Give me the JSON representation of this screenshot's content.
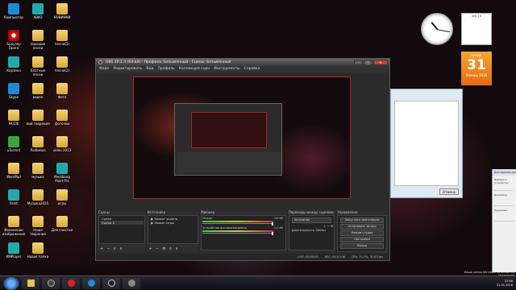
{
  "desktop": {
    "icons": [
      {
        "label": "Компьютер",
        "type": "computer"
      },
      {
        "label": "АВИЗ",
        "type": "app"
      },
      {
        "label": "НОВИНКИ",
        "type": "folder"
      },
      {
        "label": "Браузер Opera",
        "type": "opera"
      },
      {
        "label": "хорошие песни",
        "type": "folder"
      },
      {
        "label": "песни(1)",
        "type": "folder"
      },
      {
        "label": "Корзина",
        "type": "trash"
      },
      {
        "label": "Блатные песни",
        "type": "folder"
      },
      {
        "label": "песни(2)",
        "type": "folder"
      },
      {
        "label": "Skype",
        "type": "skype"
      },
      {
        "label": "видео",
        "type": "folder"
      },
      {
        "label": "Фото",
        "type": "folder"
      },
      {
        "label": "MUZIK",
        "type": "folder"
      },
      {
        "label": "мой творения",
        "type": "folder"
      },
      {
        "label": "фоточки",
        "type": "folder"
      },
      {
        "label": "uTorrent",
        "type": "utorrent"
      },
      {
        "label": "Любимое",
        "type": "folder"
      },
      {
        "label": "video 2013",
        "type": "folder"
      },
      {
        "label": "WordPad",
        "type": "folder"
      },
      {
        "label": "музыка",
        "type": "folder"
      },
      {
        "label": "Medibang Paint Pro",
        "type": "app"
      },
      {
        "label": "Paint",
        "type": "app"
      },
      {
        "label": "Музыка2015",
        "type": "folder"
      },
      {
        "label": "игры",
        "type": "folder"
      },
      {
        "label": "Изменение изображения",
        "type": "folder"
      },
      {
        "label": "Наше творение",
        "type": "folder"
      },
      {
        "label": "Для очистки",
        "type": "folder"
      },
      {
        "label": "KMPlayer",
        "type": "app"
      },
      {
        "label": "Новая папка",
        "type": "folder"
      }
    ]
  },
  "gadgets": {
    "calendar_small_header": "янв 18",
    "calendar_big": {
      "weekday": "среда",
      "day": "31",
      "month_year": "Январь 2018"
    }
  },
  "obs": {
    "title": "OBS 20.1.3 (64-bit) - Профиль: Безымянный - Сцены: Безымянный",
    "window_buttons": {
      "minimize": "–",
      "maximize": "□",
      "close": "✕"
    },
    "menu": [
      "Файл",
      "Редактировать",
      "Вид",
      "Профиль",
      "Коллекция сцен",
      "Инструменты",
      "Справка"
    ],
    "panels": {
      "scenes": {
        "title": "Сцены",
        "items": [
          "Сцена",
          "Сцена 2"
        ]
      },
      "sources": {
        "title": "Источники",
        "items": [
          "Захват экрана",
          "Захват игры"
        ]
      },
      "mixer": {
        "title": "Микшер",
        "channels": [
          {
            "name": "Микро",
            "db": "0.0 dB",
            "level": 0.7
          },
          {
            "name": "Устройство воспроизведения",
            "db": "0.0 dB",
            "level": 0.55
          }
        ]
      },
      "transitions": {
        "title": "Переходы между сценами",
        "selected": "Затухание",
        "duration_label": "Длительность",
        "duration_value": "300ms"
      },
      "controls": {
        "title": "Управление",
        "buttons": [
          "Запустить трансляцию",
          "Остановить запись",
          "Режим студии",
          "Настройки",
          "Выход"
        ]
      }
    },
    "status": {
      "live": "LIVE: 00:00:00",
      "rec": "REC: 00:07:06",
      "cpu": "CPU: 70.7%, 31.63 fps"
    },
    "tools": {
      "add": "+",
      "remove": "−",
      "up": "∧",
      "down": "∨",
      "settings": "⚙"
    }
  },
  "background_window": {
    "button": "Отмена"
  },
  "side_panel": {
    "title": "Воспроизведение",
    "items": [
      "Выберите устройство",
      "Динамики",
      "Наушники"
    ]
  },
  "watermark": {
    "line1": "Ваша копия Windows не является подлинной",
    "time": "22:06",
    "date": "31.01.2018"
  },
  "colors": {
    "accent_red": "#c8412d",
    "obs_bg": "#2b2b2b",
    "calendar_orange": "#f08a1c"
  }
}
